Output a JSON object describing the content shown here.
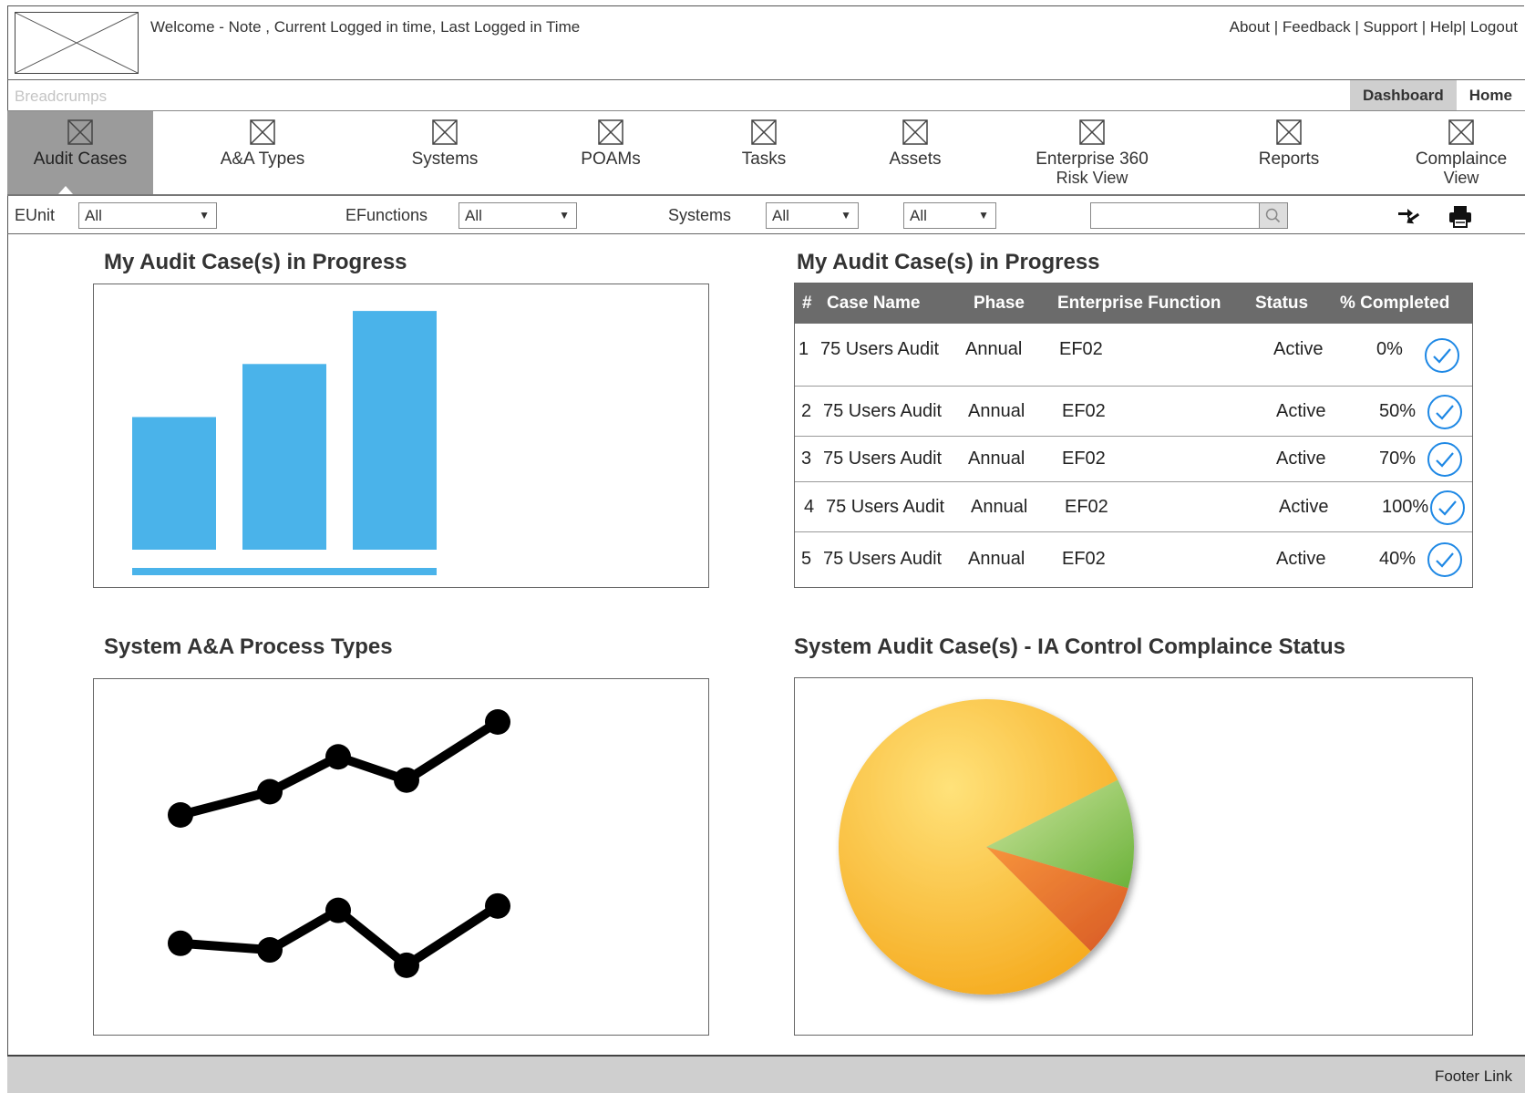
{
  "header": {
    "welcome": "Welcome - Note , Current Logged in time, Last Logged in Time",
    "links": [
      "About",
      "Feedback",
      "Support",
      "Help",
      "Logout"
    ]
  },
  "breadcrumb": {
    "text": "Breadcrumps",
    "tabs": [
      "Dashboard",
      "Home"
    ]
  },
  "nav": {
    "items": [
      {
        "label": "Audit Cases",
        "sub": ""
      },
      {
        "label": "A&A Types",
        "sub": ""
      },
      {
        "label": "Systems",
        "sub": ""
      },
      {
        "label": "POAMs",
        "sub": ""
      },
      {
        "label": "Tasks",
        "sub": ""
      },
      {
        "label": "Assets",
        "sub": ""
      },
      {
        "label": "Enterprise 360",
        "sub": "Risk View"
      },
      {
        "label": "Reports",
        "sub": ""
      },
      {
        "label": "Complaince",
        "sub": "View"
      }
    ]
  },
  "filters": {
    "eunit_label": "EUnit",
    "eunit_value": "All",
    "efunctions_label": "EFunctions",
    "efunctions_value": "All",
    "systems_label": "Systems",
    "systems_value": "All",
    "extra_value": "All",
    "search_value": ""
  },
  "sections": {
    "bar_title": "My Audit Case(s) in Progress",
    "table_title": "My Audit Case(s) in Progress",
    "line_title": "System A&A Process Types",
    "pie_title": "System Audit Case(s) - IA Control Complaince Status"
  },
  "table": {
    "headers": [
      "#",
      "Case Name",
      "Phase",
      "Enterprise Function",
      "Status",
      "% Completed"
    ],
    "rows": [
      {
        "num": "1",
        "name": "75 Users Audit",
        "phase": "Annual",
        "ef": "EF02",
        "status": "Active",
        "pct": "0%"
      },
      {
        "num": "2",
        "name": "75 Users Audit",
        "phase": "Annual",
        "ef": "EF02",
        "status": "Active",
        "pct": "50%"
      },
      {
        "num": "3",
        "name": "75 Users Audit",
        "phase": "Annual",
        "ef": "EF02",
        "status": "Active",
        "pct": "70%"
      },
      {
        "num": "4",
        "name": "75 Users Audit",
        "phase": "Annual",
        "ef": "EF02",
        "status": "Active",
        "pct": "100%"
      },
      {
        "num": "5",
        "name": "75 Users Audit",
        "phase": "Annual",
        "ef": "EF02",
        "status": "Active",
        "pct": "40%"
      }
    ]
  },
  "chart_data": [
    {
      "type": "bar",
      "title": "My Audit Case(s) in Progress",
      "categories": [
        "",
        "",
        ""
      ],
      "values": [
        50,
        70,
        90
      ],
      "ylim": [
        0,
        100
      ],
      "color": "#4ab3ea"
    },
    {
      "type": "line",
      "title": "System A&A Process Types",
      "x": [
        1,
        2,
        3,
        4,
        5
      ],
      "series": [
        {
          "values": [
            20,
            30,
            45,
            35,
            60
          ]
        },
        {
          "values": [
            25,
            22,
            40,
            15,
            42
          ]
        }
      ],
      "color": "#000000"
    },
    {
      "type": "pie",
      "title": "System Audit Case(s) - IA Control Complaince Status",
      "values": [
        80,
        12,
        8
      ],
      "colors": [
        "#ffc61a",
        "#a6d26a",
        "#f0792e"
      ]
    }
  ],
  "footer": {
    "link": "Footer Link"
  },
  "colors": {
    "accent": "#4ab3ea",
    "check": "#1e88e5",
    "nav_active": "#9b9b9b",
    "table_header": "#6b6b6b"
  }
}
